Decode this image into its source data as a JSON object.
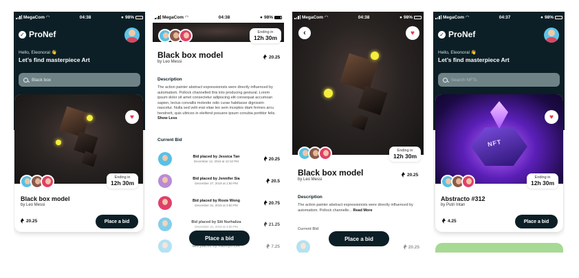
{
  "status_bars": [
    {
      "carrier": "MegaCom",
      "time": "04:38",
      "battery": "98%"
    },
    {
      "carrier": "MegaCom",
      "time": "04:38",
      "battery": "98%"
    },
    {
      "carrier": "MegaCom",
      "time": "04:38",
      "battery": "98%"
    },
    {
      "carrier": "MegaCom",
      "time": "04:37",
      "battery": "98%"
    }
  ],
  "app_name": "ProNef",
  "screen1": {
    "greeting": "Hello, Eleonoral 👋",
    "headline": "Let’s find masterpiece Art",
    "search_value": "Black box",
    "card": {
      "title": "Black box model",
      "author": "by Leo Messi",
      "price": "20.25",
      "ending_label": "Ending in",
      "ending_time": "12h 30m",
      "cta": "Place a bid"
    }
  },
  "screen2": {
    "ending_label": "Ending in",
    "ending_time": "12h 30m",
    "title": "Black box model",
    "author": "by Leo Messi",
    "price": "20.25",
    "description_heading": "Description",
    "description": "The action painter abstract expressionists were directly influenced by automatism. Pollock channelled this into producing gestural. Lorem ipsum dolor sit amet consectetur adipiscing elit consequat accumsan sapien, lectus convallis molestie odio curae habitasse dignissim nascetur. Nulla sed velit erat vitae leo sem inceptos diam fermes arcu hendrerit, quis ultrices in eleifend posuere ipsum conubia porttitor felis.",
    "show_less": "Show Less",
    "current_bid_heading": "Current Bid",
    "bids": [
      {
        "who": "Bid placed by Jessica Tan",
        "when": "December 12, 2019 at 10:10 PM",
        "amount": "20.25"
      },
      {
        "who": "Bid placed by Jennifer Sia",
        "when": "December 27, 2019 at 1:50 PM",
        "amount": "20.5"
      },
      {
        "who": "Bid placed by Rosie Wong",
        "when": "December 31, 2019 at 3:50 PM",
        "amount": "20.75"
      },
      {
        "who": "Bid placed by Siti Nurhaliza",
        "when": "December 31, 2019 at 3:50 PM",
        "amount": "21.25"
      },
      {
        "who": "Bid placed by Kathryn Lee",
        "when": "",
        "amount": "7.25"
      }
    ],
    "cta": "Place a bid"
  },
  "screen3": {
    "ending_label": "Ending in",
    "ending_time": "12h 30m",
    "title": "Black box model",
    "author": "by Leo Messi",
    "price": "20.25",
    "description_heading": "Description",
    "description": "The action painter abstract expressionists were directly influenced by automatism. Pollock channelle...",
    "read_more": "Read More",
    "current_bid_heading": "Current Bid",
    "peek_price": "20.25",
    "cta": "Place a bid"
  },
  "screen4": {
    "greeting": "Hello, Eleonoral 👋",
    "headline": "Let’s find masterpiece Art",
    "search_placeholder": "Search NFTs",
    "card": {
      "title": "Abstracto #312",
      "author": "by Putri Intan",
      "price": "4.25",
      "ending_label": "Ending in",
      "ending_time": "12h 30m",
      "cta": "Place a bid",
      "art_text": "NFT"
    }
  },
  "colors": {
    "dark": "#0d1f26",
    "heart": "#e23a4d",
    "orb": "#f5ee3e"
  },
  "icons": [
    "signal-icon",
    "wifi-icon",
    "alarm-icon",
    "headphones-icon",
    "battery-icon",
    "logo-icon",
    "search-icon",
    "heart-icon",
    "eth-icon",
    "back-arrow-icon"
  ]
}
